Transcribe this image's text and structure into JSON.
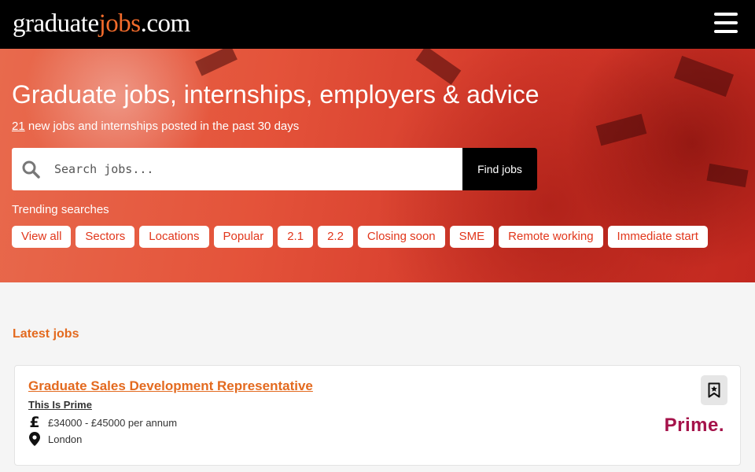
{
  "header": {
    "logo_part1": "graduate",
    "logo_part2": "jobs",
    "logo_part3": ".com",
    "menu_icon": "hamburger-menu-icon"
  },
  "hero": {
    "title": "Graduate jobs, internships, employers & advice",
    "job_count": "21",
    "subtitle_rest": " new jobs and internships posted in the past 30 days",
    "search_placeholder": "Search jobs...",
    "search_button": "Find jobs",
    "trending_label": "Trending searches",
    "trending": [
      "View all",
      "Sectors",
      "Locations",
      "Popular",
      "2.1",
      "2.2",
      "Closing soon",
      "SME",
      "Remote working",
      "Immediate start"
    ]
  },
  "latest": {
    "heading": "Latest jobs",
    "jobs": [
      {
        "title": "Graduate Sales Development Representative",
        "company": "This Is Prime",
        "salary": "£34000 - £45000 per annum",
        "location": "London",
        "logo_text": "Prime."
      }
    ]
  },
  "colors": {
    "accent": "#e36a1f",
    "chip_text": "#e1361b",
    "header_bg": "#000000",
    "logo_brand": "#a5124a"
  }
}
